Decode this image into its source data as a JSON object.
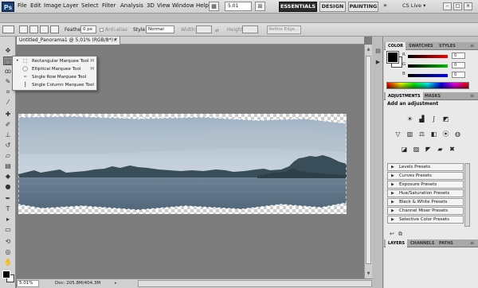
{
  "menubar": {
    "app_logo": "Ps",
    "menus": [
      "File",
      "Edit",
      "Image",
      "Layer",
      "Select",
      "Filter",
      "Analysis",
      "3D",
      "View",
      "Window",
      "Help"
    ],
    "zoom": "5.01",
    "workspaces": [
      "ESSENTIALS",
      "DESIGN",
      "PAINTING"
    ],
    "more": "»",
    "cs_live": "CS Live ▾",
    "window_controls": [
      "–",
      "□",
      "×"
    ]
  },
  "options": {
    "feather_label": "Feather:",
    "feather_value": "0 px",
    "antialias_label": "Anti-alias",
    "style_label": "Style:",
    "style_value": "Normal",
    "width_label": "Width:",
    "height_label": "Height:",
    "refine_edge": "Refine Edge..."
  },
  "document": {
    "tab_title": "Untitled_Panorama1 @ 5.01% (RGB/8*) *",
    "tab_close": "×",
    "status_zoom": "5.01%",
    "status_doc": "Doc: 205.8M/404.3M",
    "status_arrow": "▸"
  },
  "flyout": {
    "items": [
      {
        "label": "Rectangular Marquee Tool",
        "shortcut": "M",
        "icon": "rect-marquee-icon",
        "glyph": "⬚",
        "selected": true
      },
      {
        "label": "Elliptical Marquee Tool",
        "shortcut": "M",
        "icon": "ellipse-marquee-icon",
        "glyph": "◯",
        "selected": false
      },
      {
        "label": "Single Row Marquee Tool",
        "shortcut": "",
        "icon": "single-row-marquee-icon",
        "glyph": "┅",
        "selected": false
      },
      {
        "label": "Single Column Marquee Tool",
        "shortcut": "",
        "icon": "single-column-marquee-icon",
        "glyph": "┇",
        "selected": false
      }
    ],
    "bullet": "•"
  },
  "tools": [
    {
      "name": "move-tool-icon",
      "glyph": "✥"
    },
    {
      "name": "rect-marquee-tool-icon",
      "glyph": "⬚"
    },
    {
      "name": "lasso-tool-icon",
      "glyph": "ꝏ"
    },
    {
      "name": "quick-select-tool-icon",
      "glyph": "✎"
    },
    {
      "name": "crop-tool-icon",
      "glyph": "⌗"
    },
    {
      "name": "eyedropper-tool-icon",
      "glyph": "⁄"
    },
    {
      "name": "healing-brush-tool-icon",
      "glyph": "✚"
    },
    {
      "name": "brush-tool-icon",
      "glyph": "✐"
    },
    {
      "name": "clone-stamp-tool-icon",
      "glyph": "⊥"
    },
    {
      "name": "history-brush-tool-icon",
      "glyph": "↺"
    },
    {
      "name": "eraser-tool-icon",
      "glyph": "▱"
    },
    {
      "name": "gradient-tool-icon",
      "glyph": "▤"
    },
    {
      "name": "blur-tool-icon",
      "glyph": "◆"
    },
    {
      "name": "dodge-tool-icon",
      "glyph": "●"
    },
    {
      "name": "pen-tool-icon",
      "glyph": "✒"
    },
    {
      "name": "type-tool-icon",
      "glyph": "T"
    },
    {
      "name": "path-select-tool-icon",
      "glyph": "▸"
    },
    {
      "name": "shape-tool-icon",
      "glyph": "▭"
    },
    {
      "name": "3d-rotate-tool-icon",
      "glyph": "⟲"
    },
    {
      "name": "3d-orbit-tool-icon",
      "glyph": "◎"
    },
    {
      "name": "hand-tool-icon",
      "glyph": "✋"
    },
    {
      "name": "zoom-tool-icon",
      "glyph": "⚲"
    }
  ],
  "color_panel": {
    "tabs": [
      "COLOR",
      "SWATCHES",
      "STYLES"
    ],
    "channels": [
      {
        "label": "R",
        "value": "0",
        "color": "#ff0000"
      },
      {
        "label": "G",
        "value": "0",
        "color": "#00c000"
      },
      {
        "label": "B",
        "value": "0",
        "color": "#0000ff"
      }
    ],
    "menu": "≡"
  },
  "adjustments": {
    "tabs": [
      "ADJUSTMENTS",
      "MASKS"
    ],
    "title": "Add an adjustment",
    "icons_row1": [
      {
        "name": "brightness-contrast-icon",
        "glyph": "☀"
      },
      {
        "name": "levels-icon",
        "glyph": "▟"
      },
      {
        "name": "curves-icon",
        "glyph": "∫"
      },
      {
        "name": "exposure-icon",
        "glyph": "◩"
      }
    ],
    "icons_row2": [
      {
        "name": "vibrance-icon",
        "glyph": "▽"
      },
      {
        "name": "hue-saturation-icon",
        "glyph": "▥"
      },
      {
        "name": "color-balance-icon",
        "glyph": "⚖"
      },
      {
        "name": "black-white-icon",
        "glyph": "◧"
      },
      {
        "name": "photo-filter-icon",
        "glyph": "⦿"
      },
      {
        "name": "channel-mixer-icon",
        "glyph": "◍"
      }
    ],
    "icons_row3": [
      {
        "name": "invert-icon",
        "glyph": "◪"
      },
      {
        "name": "posterize-icon",
        "glyph": "▨"
      },
      {
        "name": "threshold-icon",
        "glyph": "◤"
      },
      {
        "name": "gradient-map-icon",
        "glyph": "▰"
      },
      {
        "name": "selective-color-icon",
        "glyph": "✖"
      }
    ],
    "presets": [
      "Levels Presets",
      "Curves Presets",
      "Exposure Presets",
      "Hue/Saturation Presets",
      "Black & White Presets",
      "Channel Mixer Presets",
      "Selective Color Presets"
    ],
    "preset_arrow": "▶",
    "footer_icons": [
      {
        "name": "return-icon",
        "glyph": "↩"
      },
      {
        "name": "clip-icon",
        "glyph": "⧉"
      }
    ]
  },
  "layers": {
    "tabs": [
      "LAYERS",
      "CHANNELS",
      "PATHS"
    ]
  },
  "colors": {
    "essentials_active": "#2c2c2c",
    "panel_bg": "#e9e9e9",
    "canvas_bg": "#7d7d7d"
  }
}
